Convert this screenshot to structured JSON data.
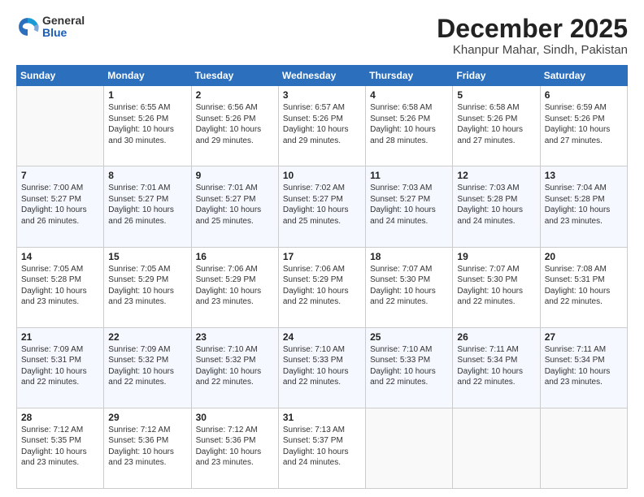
{
  "logo": {
    "general": "General",
    "blue": "Blue"
  },
  "title": "December 2025",
  "location": "Khanpur Mahar, Sindh, Pakistan",
  "days": [
    "Sunday",
    "Monday",
    "Tuesday",
    "Wednesday",
    "Thursday",
    "Friday",
    "Saturday"
  ],
  "weeks": [
    [
      {
        "day": "",
        "sunrise": "",
        "sunset": "",
        "daylight": ""
      },
      {
        "day": "1",
        "sunrise": "Sunrise: 6:55 AM",
        "sunset": "Sunset: 5:26 PM",
        "daylight": "Daylight: 10 hours and 30 minutes."
      },
      {
        "day": "2",
        "sunrise": "Sunrise: 6:56 AM",
        "sunset": "Sunset: 5:26 PM",
        "daylight": "Daylight: 10 hours and 29 minutes."
      },
      {
        "day": "3",
        "sunrise": "Sunrise: 6:57 AM",
        "sunset": "Sunset: 5:26 PM",
        "daylight": "Daylight: 10 hours and 29 minutes."
      },
      {
        "day": "4",
        "sunrise": "Sunrise: 6:58 AM",
        "sunset": "Sunset: 5:26 PM",
        "daylight": "Daylight: 10 hours and 28 minutes."
      },
      {
        "day": "5",
        "sunrise": "Sunrise: 6:58 AM",
        "sunset": "Sunset: 5:26 PM",
        "daylight": "Daylight: 10 hours and 27 minutes."
      },
      {
        "day": "6",
        "sunrise": "Sunrise: 6:59 AM",
        "sunset": "Sunset: 5:26 PM",
        "daylight": "Daylight: 10 hours and 27 minutes."
      }
    ],
    [
      {
        "day": "7",
        "sunrise": "Sunrise: 7:00 AM",
        "sunset": "Sunset: 5:27 PM",
        "daylight": "Daylight: 10 hours and 26 minutes."
      },
      {
        "day": "8",
        "sunrise": "Sunrise: 7:01 AM",
        "sunset": "Sunset: 5:27 PM",
        "daylight": "Daylight: 10 hours and 26 minutes."
      },
      {
        "day": "9",
        "sunrise": "Sunrise: 7:01 AM",
        "sunset": "Sunset: 5:27 PM",
        "daylight": "Daylight: 10 hours and 25 minutes."
      },
      {
        "day": "10",
        "sunrise": "Sunrise: 7:02 AM",
        "sunset": "Sunset: 5:27 PM",
        "daylight": "Daylight: 10 hours and 25 minutes."
      },
      {
        "day": "11",
        "sunrise": "Sunrise: 7:03 AM",
        "sunset": "Sunset: 5:27 PM",
        "daylight": "Daylight: 10 hours and 24 minutes."
      },
      {
        "day": "12",
        "sunrise": "Sunrise: 7:03 AM",
        "sunset": "Sunset: 5:28 PM",
        "daylight": "Daylight: 10 hours and 24 minutes."
      },
      {
        "day": "13",
        "sunrise": "Sunrise: 7:04 AM",
        "sunset": "Sunset: 5:28 PM",
        "daylight": "Daylight: 10 hours and 23 minutes."
      }
    ],
    [
      {
        "day": "14",
        "sunrise": "Sunrise: 7:05 AM",
        "sunset": "Sunset: 5:28 PM",
        "daylight": "Daylight: 10 hours and 23 minutes."
      },
      {
        "day": "15",
        "sunrise": "Sunrise: 7:05 AM",
        "sunset": "Sunset: 5:29 PM",
        "daylight": "Daylight: 10 hours and 23 minutes."
      },
      {
        "day": "16",
        "sunrise": "Sunrise: 7:06 AM",
        "sunset": "Sunset: 5:29 PM",
        "daylight": "Daylight: 10 hours and 23 minutes."
      },
      {
        "day": "17",
        "sunrise": "Sunrise: 7:06 AM",
        "sunset": "Sunset: 5:29 PM",
        "daylight": "Daylight: 10 hours and 22 minutes."
      },
      {
        "day": "18",
        "sunrise": "Sunrise: 7:07 AM",
        "sunset": "Sunset: 5:30 PM",
        "daylight": "Daylight: 10 hours and 22 minutes."
      },
      {
        "day": "19",
        "sunrise": "Sunrise: 7:07 AM",
        "sunset": "Sunset: 5:30 PM",
        "daylight": "Daylight: 10 hours and 22 minutes."
      },
      {
        "day": "20",
        "sunrise": "Sunrise: 7:08 AM",
        "sunset": "Sunset: 5:31 PM",
        "daylight": "Daylight: 10 hours and 22 minutes."
      }
    ],
    [
      {
        "day": "21",
        "sunrise": "Sunrise: 7:09 AM",
        "sunset": "Sunset: 5:31 PM",
        "daylight": "Daylight: 10 hours and 22 minutes."
      },
      {
        "day": "22",
        "sunrise": "Sunrise: 7:09 AM",
        "sunset": "Sunset: 5:32 PM",
        "daylight": "Daylight: 10 hours and 22 minutes."
      },
      {
        "day": "23",
        "sunrise": "Sunrise: 7:10 AM",
        "sunset": "Sunset: 5:32 PM",
        "daylight": "Daylight: 10 hours and 22 minutes."
      },
      {
        "day": "24",
        "sunrise": "Sunrise: 7:10 AM",
        "sunset": "Sunset: 5:33 PM",
        "daylight": "Daylight: 10 hours and 22 minutes."
      },
      {
        "day": "25",
        "sunrise": "Sunrise: 7:10 AM",
        "sunset": "Sunset: 5:33 PM",
        "daylight": "Daylight: 10 hours and 22 minutes."
      },
      {
        "day": "26",
        "sunrise": "Sunrise: 7:11 AM",
        "sunset": "Sunset: 5:34 PM",
        "daylight": "Daylight: 10 hours and 22 minutes."
      },
      {
        "day": "27",
        "sunrise": "Sunrise: 7:11 AM",
        "sunset": "Sunset: 5:34 PM",
        "daylight": "Daylight: 10 hours and 23 minutes."
      }
    ],
    [
      {
        "day": "28",
        "sunrise": "Sunrise: 7:12 AM",
        "sunset": "Sunset: 5:35 PM",
        "daylight": "Daylight: 10 hours and 23 minutes."
      },
      {
        "day": "29",
        "sunrise": "Sunrise: 7:12 AM",
        "sunset": "Sunset: 5:36 PM",
        "daylight": "Daylight: 10 hours and 23 minutes."
      },
      {
        "day": "30",
        "sunrise": "Sunrise: 7:12 AM",
        "sunset": "Sunset: 5:36 PM",
        "daylight": "Daylight: 10 hours and 23 minutes."
      },
      {
        "day": "31",
        "sunrise": "Sunrise: 7:13 AM",
        "sunset": "Sunset: 5:37 PM",
        "daylight": "Daylight: 10 hours and 24 minutes."
      },
      {
        "day": "",
        "sunrise": "",
        "sunset": "",
        "daylight": ""
      },
      {
        "day": "",
        "sunrise": "",
        "sunset": "",
        "daylight": ""
      },
      {
        "day": "",
        "sunrise": "",
        "sunset": "",
        "daylight": ""
      }
    ]
  ]
}
